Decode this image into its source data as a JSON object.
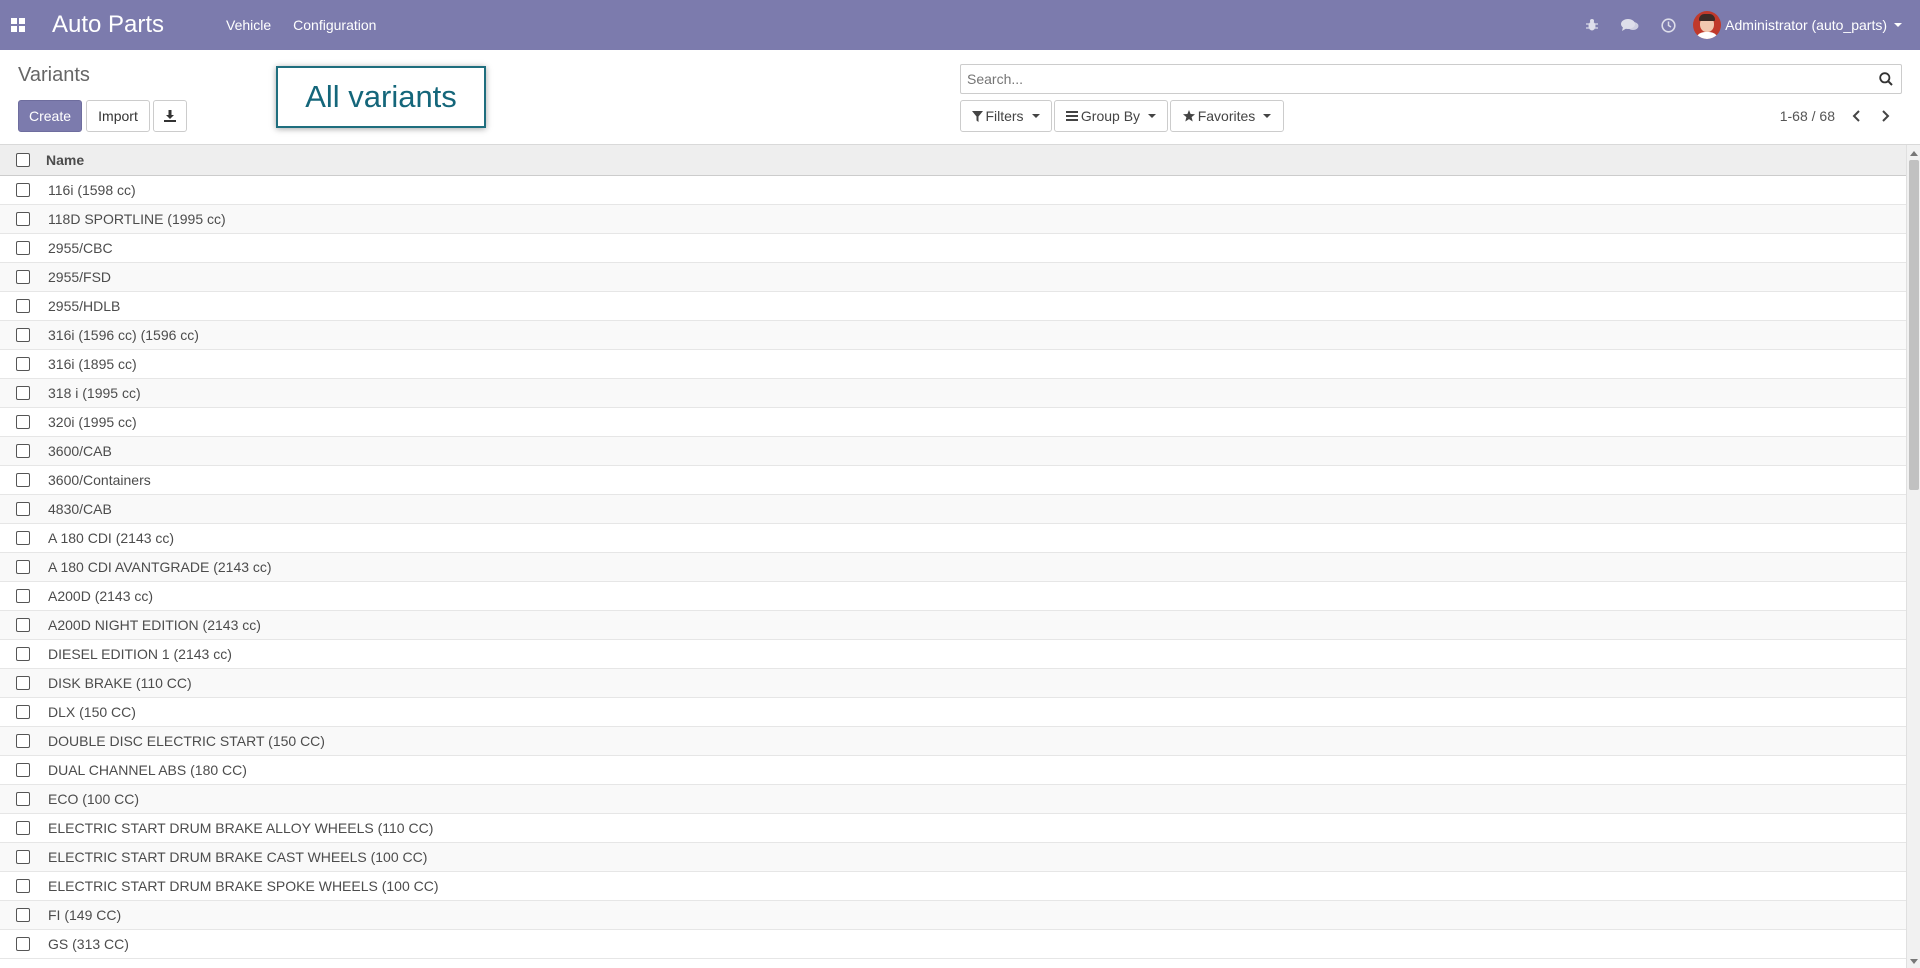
{
  "navbar": {
    "brand": "Auto Parts",
    "menu": [
      {
        "label": "Vehicle"
      },
      {
        "label": "Configuration"
      }
    ],
    "user": "Administrator (auto_parts)",
    "color": "#7c7bad"
  },
  "control": {
    "breadcrumb": "Variants",
    "create_label": "Create",
    "import_label": "Import",
    "overlay_label": "All variants",
    "search_placeholder": "Search...",
    "filters_label": "Filters",
    "groupby_label": "Group By",
    "favorites_label": "Favorites",
    "pager": "1-68 / 68"
  },
  "list": {
    "column_name": "Name",
    "rows": [
      "116i (1598 cc)",
      "118D SPORTLINE (1995 cc)",
      "2955/CBC",
      "2955/FSD",
      "2955/HDLB",
      "316i (1596 cc) (1596 cc)",
      "316i (1895 cc)",
      "318 i (1995 cc)",
      "320i (1995 cc)",
      "3600/CAB",
      "3600/Containers",
      "4830/CAB",
      "A 180 CDI (2143 cc)",
      "A 180 CDI AVANTGRADE (2143 cc)",
      "A200D (2143 cc)",
      "A200D NIGHT EDITION (2143 cc)",
      "DIESEL EDITION 1 (2143 cc)",
      "DISK BRAKE (110 CC)",
      "DLX (150 CC)",
      "DOUBLE DISC ELECTRIC START (150 CC)",
      "DUAL CHANNEL ABS (180 CC)",
      "ECO (100 CC)",
      "ELECTRIC START DRUM BRAKE ALLOY WHEELS (110 CC)",
      "ELECTRIC START DRUM BRAKE CAST WHEELS (100 CC)",
      "ELECTRIC START DRUM BRAKE SPOKE WHEELS (100 CC)",
      "FI (149 CC)",
      "GS (313 CC)"
    ]
  }
}
